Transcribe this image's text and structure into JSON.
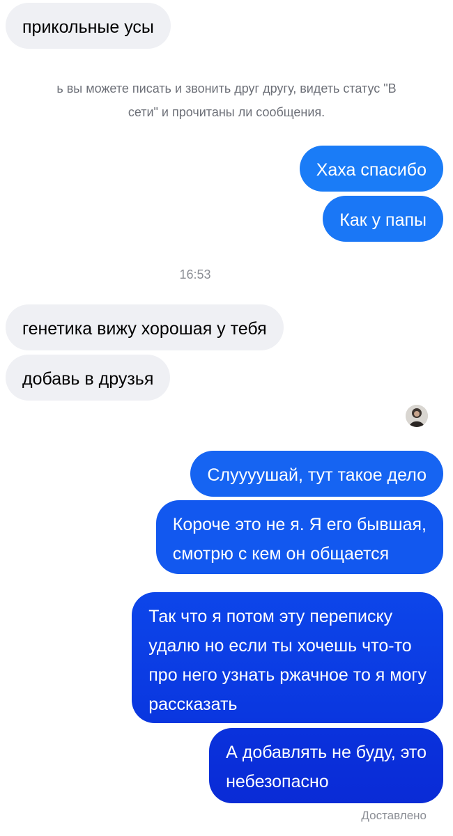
{
  "messages": {
    "in_1": "прикольные усы",
    "system_line_1": "ь вы можете писать и звонить друг другу, видеть статус \"В",
    "system_line_2": "сети\" и прочитаны ли сообщения.",
    "out_1": "Хаха спасибо",
    "out_2": "Как у папы",
    "time": "16:53",
    "in_2": "генетика вижу хорошая у тебя",
    "in_3": "добавь в друзья",
    "out_3": "Слуууушай, тут такое дело",
    "out_4_line_1": "Короче это не я. Я его бывшая,",
    "out_4_line_2": "смотрю с кем он общается",
    "out_5_line_1": "Так что я потом эту переписку",
    "out_5_line_2": "удалю но если ты хочешь что-то",
    "out_5_line_3": "про него узнать ржачное то я могу",
    "out_5_line_4": "рассказать",
    "out_6_line_1": "А добавлять не буду, это",
    "out_6_line_2": "небезопасно",
    "status": "Доставлено"
  },
  "colors": {
    "incoming_bubble": "#eff0f4",
    "outgoing_top": "#1a7cf7",
    "outgoing_bottom": "#0a2fd9",
    "meta_text": "#8b8e95"
  },
  "icons": {
    "avatar": "sender-avatar"
  }
}
